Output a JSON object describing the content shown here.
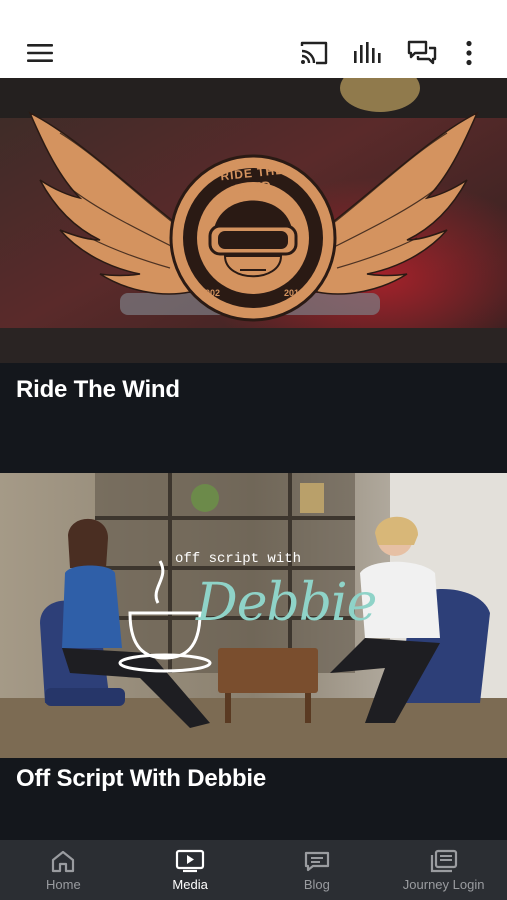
{
  "header": {
    "menu_icon": "hamburger-menu-icon",
    "actions": [
      {
        "icon": "cast-icon"
      },
      {
        "icon": "audio-bars-icon"
      },
      {
        "icon": "chat-bubbles-icon"
      },
      {
        "icon": "more-vertical-icon"
      }
    ]
  },
  "feed": {
    "items": [
      {
        "title": "Ride The Wind",
        "logo_text": "RIDE THE WIND",
        "year_left": "2002",
        "year_right": "2016"
      },
      {
        "title": "Off Script With Debbie",
        "logo_small": "off script with",
        "logo_big": "Debbie"
      }
    ]
  },
  "bottom_nav": {
    "items": [
      {
        "label": "Home",
        "icon": "home-icon",
        "active": false
      },
      {
        "label": "Media",
        "icon": "tv-play-icon",
        "active": true
      },
      {
        "label": "Blog",
        "icon": "blog-icon",
        "active": false
      },
      {
        "label": "Journey Login",
        "icon": "journey-login-icon",
        "active": false
      }
    ]
  },
  "colors": {
    "accent_copper": "#d4935f",
    "teal_script": "#8fd3c8",
    "nav_bg": "#2b2e33",
    "feed_bg": "#14171c"
  }
}
